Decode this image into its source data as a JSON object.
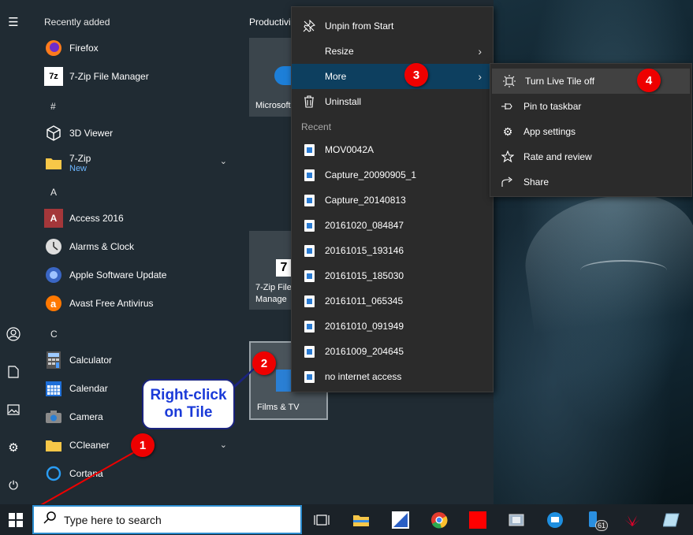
{
  "start_menu": {
    "recently_added_header": "Recently added",
    "productivity_header": "Productivi",
    "sections": {
      "hash": "#",
      "a": "A",
      "c": "C"
    },
    "recent_apps": [
      {
        "name": "Firefox"
      },
      {
        "name": "7-Zip File Manager"
      }
    ],
    "apps": [
      {
        "name": "3D Viewer"
      },
      {
        "name": "7-Zip",
        "sub": "New"
      },
      {
        "name": "Access 2016"
      },
      {
        "name": "Alarms & Clock"
      },
      {
        "name": "Apple Software Update"
      },
      {
        "name": "Avast Free Antivirus"
      },
      {
        "name": "Calculator"
      },
      {
        "name": "Calendar"
      },
      {
        "name": "Camera"
      },
      {
        "name": "CCleaner"
      },
      {
        "name": "Cortana"
      }
    ],
    "tiles": {
      "edge_label": "Microsoft",
      "zip_label_1": "7-Zip File",
      "zip_label_2": "Manage",
      "films_label": "Films & TV"
    }
  },
  "context_menu": {
    "items": [
      {
        "label": "Unpin from Start",
        "icon": "unpin-icon"
      },
      {
        "label": "Resize",
        "icon": ""
      },
      {
        "label": "More",
        "icon": ""
      },
      {
        "label": "Uninstall",
        "icon": "trash-icon"
      }
    ],
    "recent_header": "Recent",
    "recent_files": [
      "MOV0042A",
      "Capture_20090905_1",
      "Capture_20140813",
      "20161020_084847",
      "20161015_193146",
      "20161015_185030",
      "20161011_065345",
      "20161010_091949",
      "20161009_204645",
      "no internet access"
    ]
  },
  "submenu": {
    "items": [
      {
        "label": "Turn Live Tile off",
        "icon": "live-tile-icon"
      },
      {
        "label": "Pin to taskbar",
        "icon": "pin-icon"
      },
      {
        "label": "App settings",
        "icon": "gear-icon"
      },
      {
        "label": "Rate and review",
        "icon": "star-icon"
      },
      {
        "label": "Share",
        "icon": "share-icon"
      }
    ]
  },
  "annotations": {
    "badge1": "1",
    "badge2": "2",
    "badge3": "3",
    "badge4": "4",
    "callout_line1": "Right-click",
    "callout_line2": "on Tile",
    "color": "#ee0000"
  },
  "taskbar": {
    "search_placeholder": "Type here to search",
    "phone_badge": "61"
  },
  "colors": {
    "menu_highlight": "#0d3f5f",
    "submenu_highlight": "#414141",
    "start_bg": "#202b33"
  }
}
